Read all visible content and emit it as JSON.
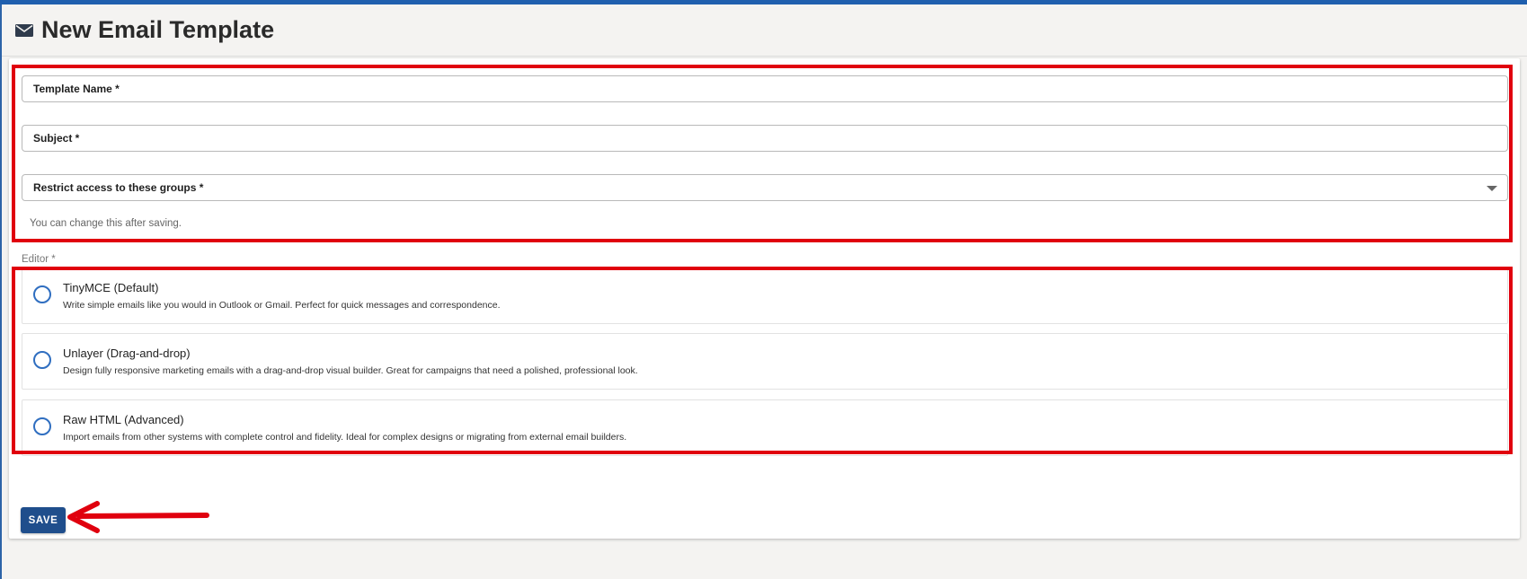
{
  "page": {
    "title": "New Email Template",
    "title_icon": "envelope-icon"
  },
  "form": {
    "template_name_label": "Template Name *",
    "subject_label": "Subject *",
    "groups_label": "Restrict access to these groups *",
    "groups_helper": "You can change this after saving.",
    "editor_label": "Editor *"
  },
  "editors": [
    {
      "title": "TinyMCE (Default)",
      "description": "Write simple emails like you would in Outlook or Gmail. Perfect for quick messages and correspondence.",
      "selected": false
    },
    {
      "title": "Unlayer (Drag-and-drop)",
      "description": "Design fully responsive marketing emails with a drag-and-drop visual builder. Great for campaigns that need a polished, professional look.",
      "selected": false
    },
    {
      "title": "Raw HTML (Advanced)",
      "description": "Import emails from other systems with complete control and fidelity. Ideal for complex designs or migrating from external email builders.",
      "selected": false
    }
  ],
  "actions": {
    "save_label": "SAVE"
  },
  "colors": {
    "top_bar": "#1f5fae",
    "primary_button": "#1f4e8c",
    "radio": "#2f6ec0",
    "annotation": "#e0000e"
  }
}
